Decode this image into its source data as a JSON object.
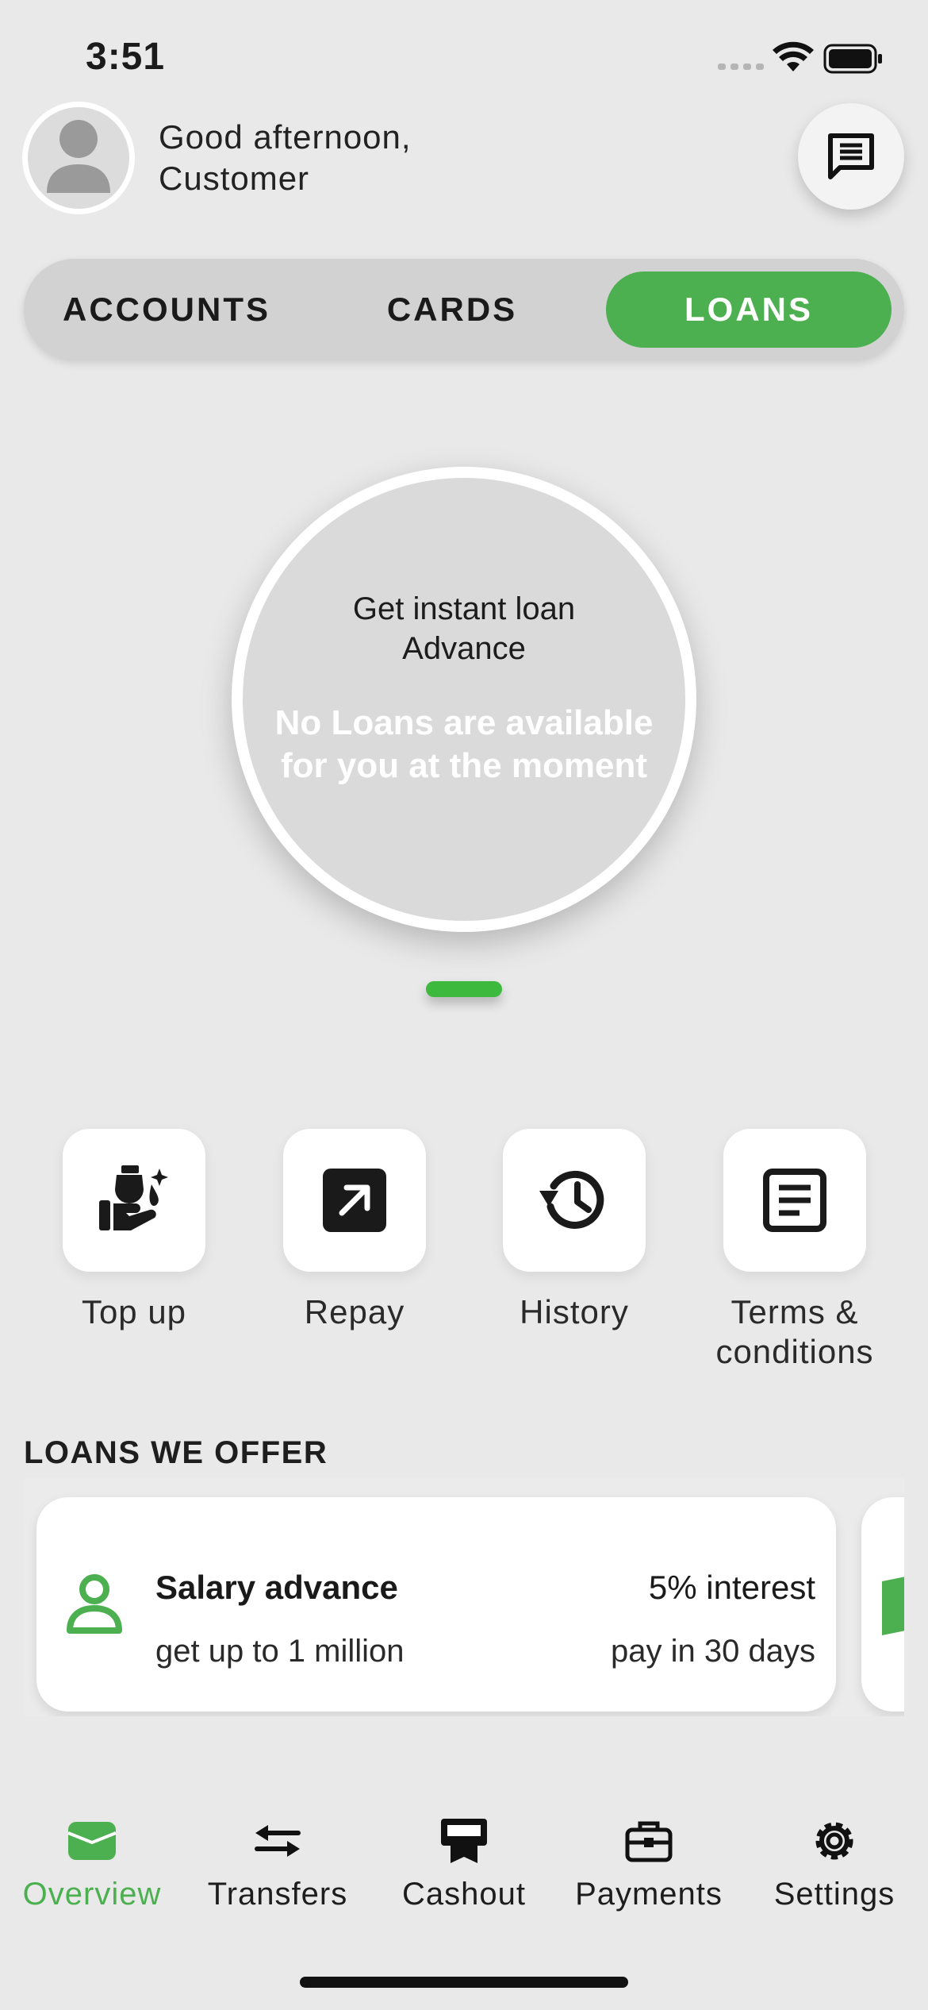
{
  "status": {
    "time": "3:51"
  },
  "header": {
    "greeting_line1": "Good afternoon,",
    "greeting_line2": "Customer"
  },
  "tabs": [
    {
      "label": "ACCOUNTS",
      "active": false
    },
    {
      "label": "CARDS",
      "active": false
    },
    {
      "label": "LOANS",
      "active": true
    }
  ],
  "loan_circle": {
    "title_line1": "Get instant loan",
    "title_line2": "Advance",
    "message": "No Loans are available for you at the moment"
  },
  "actions": [
    {
      "label": "Top up",
      "icon": "hand-coins-icon"
    },
    {
      "label": "Repay",
      "icon": "arrow-up-right-icon"
    },
    {
      "label": "History",
      "icon": "history-icon"
    },
    {
      "label": "Terms & conditions",
      "icon": "document-icon"
    }
  ],
  "offers": {
    "title": "LOANS WE OFFER",
    "items": [
      {
        "name": "Salary advance",
        "subtitle": "get up to 1 million",
        "rate": "5% interest",
        "term": "pay in 30 days",
        "icon": "person-icon"
      }
    ]
  },
  "nav": [
    {
      "label": "Overview",
      "icon": "wallet-icon",
      "active": true
    },
    {
      "label": "Transfers",
      "icon": "transfer-arrows-icon",
      "active": false
    },
    {
      "label": "Cashout",
      "icon": "atm-icon",
      "active": false
    },
    {
      "label": "Payments",
      "icon": "briefcase-icon",
      "active": false
    },
    {
      "label": "Settings",
      "icon": "gear-icon",
      "active": false
    }
  ],
  "colors": {
    "accent": "#4cb050",
    "background": "#e9e9e9",
    "card": "#ffffff"
  }
}
